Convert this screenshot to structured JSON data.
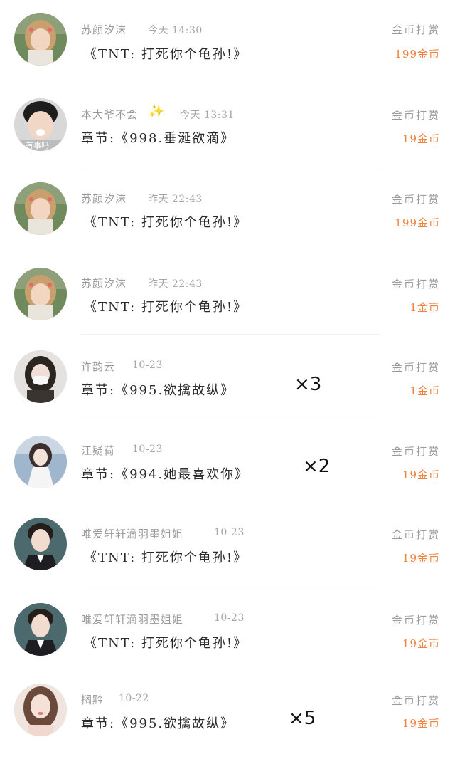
{
  "tips": [
    {
      "username": "苏颜汐沫",
      "time": "今天 14:30",
      "content": "《TNT: 打死你个龟孙!》",
      "action": "金币打赏",
      "amount": "199金币",
      "avatar": "girl-hair-clips"
    },
    {
      "username": "本大爷不会",
      "sparkle": "✨",
      "time": "今天 13:31",
      "content": "章节:《998.垂涎欲滴》",
      "action": "金币打赏",
      "amount": "19金币",
      "avatar": "boy-caption",
      "avatar_caption": "有事吗"
    },
    {
      "username": "苏颜汐沫",
      "time": "昨天 22:43",
      "content": "《TNT: 打死你个龟孙!》",
      "action": "金币打赏",
      "amount": "199金币",
      "avatar": "girl-hair-clips"
    },
    {
      "username": "苏颜汐沫",
      "time": "昨天 22:43",
      "content": "《TNT: 打死你个龟孙!》",
      "action": "金币打赏",
      "amount": "1金币",
      "avatar": "girl-hair-clips"
    },
    {
      "username": "许韵云",
      "time": "10-23",
      "content": "章节:《995.欲擒故纵》",
      "action": "金币打赏",
      "amount": "1金币",
      "avatar": "girl-mask",
      "multiplier": "×3"
    },
    {
      "username": "江疑荷",
      "time": "10-23",
      "content": "章节:《994.她最喜欢你》",
      "action": "金币打赏",
      "amount": "19金币",
      "avatar": "girl-white",
      "multiplier": "×2"
    },
    {
      "username": "唯爱轩轩滴羽墨姐姐",
      "time": "10-23",
      "content": "《TNT: 打死你个龟孙!》",
      "action": "金币打赏",
      "amount": "19金币",
      "avatar": "boy-suit"
    },
    {
      "username": "唯爱轩轩滴羽墨姐姐",
      "time": "10-23",
      "content": "《TNT: 打死你个龟孙!》",
      "action": "金币打赏",
      "amount": "19金币",
      "avatar": "boy-suit"
    },
    {
      "username": "搁黔",
      "time": "10-22",
      "content": "章节:《995.欲擒故纵》",
      "action": "金币打赏",
      "amount": "19金币",
      "avatar": "girl-long-hair",
      "multiplier": "×5"
    }
  ],
  "colors": {
    "amount": "#f0823c",
    "meta": "#9a9a9a",
    "content": "#2a2a2a",
    "divider": "#f2f2f2"
  }
}
